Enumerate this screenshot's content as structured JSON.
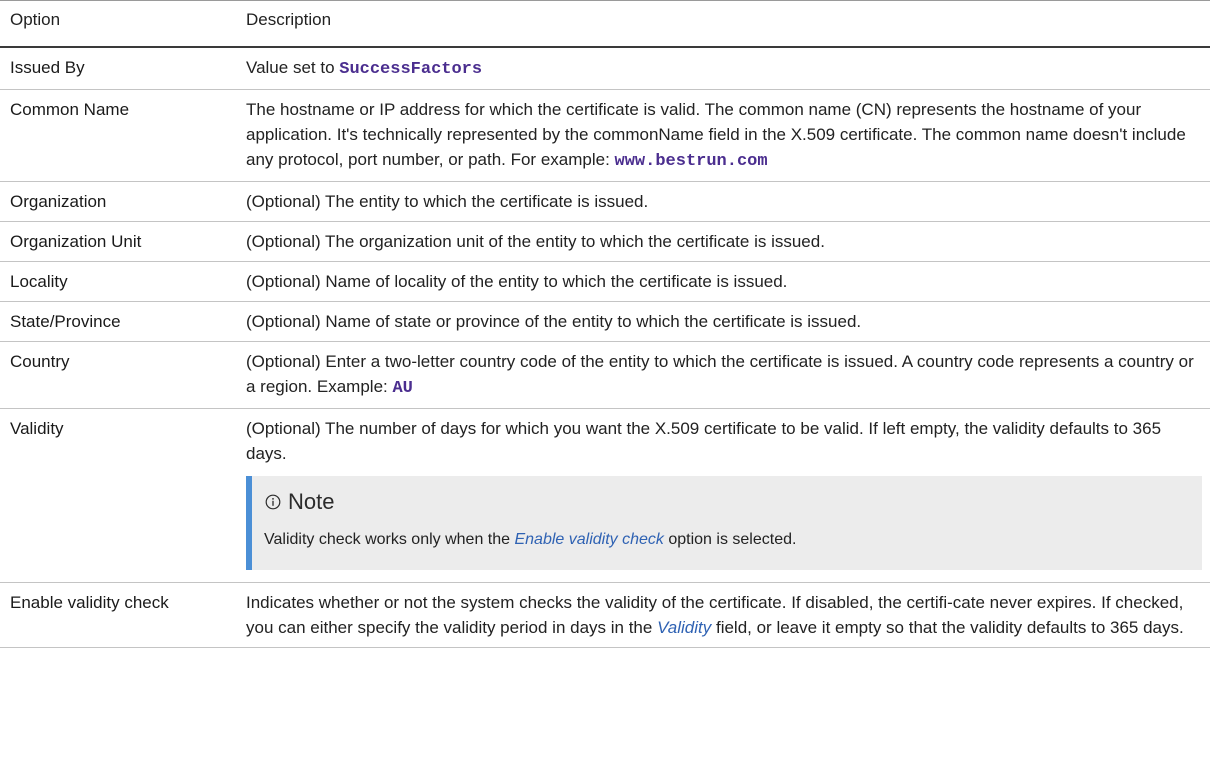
{
  "header": {
    "option": "Option",
    "description": "Description"
  },
  "rows": {
    "issued_by": {
      "option": "Issued By",
      "text_before": "Value set to ",
      "code": "SuccessFactors"
    },
    "common_name": {
      "option": "Common Name",
      "text_before": "The hostname or IP address for which the certificate is valid. The common name (CN) represents the hostname of your application. It's technically represented by the commonName field in the X.509 certificate. The common name doesn't include any protocol, port number, or path. For example: ",
      "code": "www.bestrun.com"
    },
    "organization": {
      "option": "Organization",
      "text": "(Optional) The entity to which the certificate is issued."
    },
    "organization_unit": {
      "option": "Organization Unit",
      "text": "(Optional) The organization unit of the entity to which the certificate is issued."
    },
    "locality": {
      "option": "Locality",
      "text": "(Optional) Name of locality of the entity to which the certificate is issued."
    },
    "state": {
      "option": "State/Province",
      "text": "(Optional) Name of state or province of the entity to which the certificate is issued."
    },
    "country": {
      "option": "Country",
      "text_before": "(Optional) Enter a two-letter country code of the entity to which the certificate is issued. A country code represents a country or a region. Example: ",
      "code": "AU"
    },
    "validity": {
      "option": "Validity",
      "text": "(Optional) The number of days for which you want the X.509 certificate to be valid. If left empty, the validity defaults to 365 days.",
      "note": {
        "icon": "info-icon",
        "title": "Note",
        "text_before": "Validity check works only when the ",
        "link": "Enable validity check",
        "text_after": " option is selected."
      }
    },
    "enable_validity_check": {
      "option": "Enable validity check",
      "text_before": "Indicates whether or not the system checks the validity of the certificate. If disabled, the certifi-cate never expires. If checked, you can either specify the validity period in days in the ",
      "link": "Validity",
      "text_after": " field, or leave it empty so that the validity defaults to 365 days."
    }
  },
  "colors": {
    "code": "#4b2e8f",
    "link": "#2f62b3",
    "note_bar": "#4b8fd6",
    "note_bg": "#ececec"
  }
}
